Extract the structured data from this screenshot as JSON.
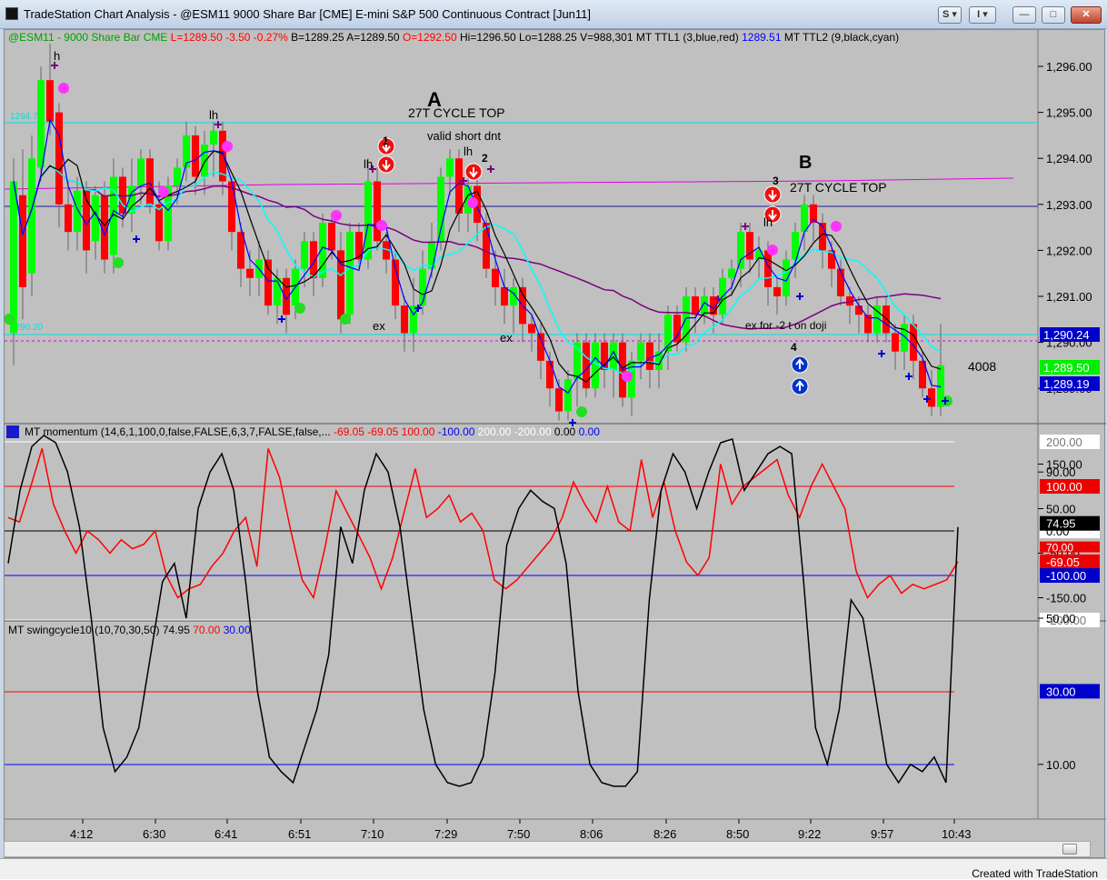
{
  "window": {
    "title": "TradeStation Chart Analysis - @ESM11 9000 Share Bar [CME] E-mini S&P 500 Continuous Contract [Jun11]",
    "buttons": {
      "s_label": "S",
      "i_label": "I",
      "minimize": "—",
      "maximize": "□",
      "close": "✕"
    }
  },
  "price_pane": {
    "header": [
      {
        "text": "@ESM11 - 9000 Share Bar  CME",
        "color": "#00a000"
      },
      {
        "text": "L=1289.50  -3.50  -0.27%",
        "color": "#ff0000"
      },
      {
        "text": "B=1289.25  A=1289.50",
        "color": "#000000"
      },
      {
        "text": "O=1292.50",
        "color": "#ff0000"
      },
      {
        "text": "Hi=1296.50  Lo=1288.25  V=988,301  MT  TTL1 (3,blue,red)",
        "color": "#000000"
      },
      {
        "text": "1289.51",
        "color": "#0000ff"
      },
      {
        "text": "MT  TTL2 (9,black,cyan)",
        "color": "#000000"
      }
    ],
    "axis_ticks": [
      "1,296.00",
      "1,295.00",
      "1,294.00",
      "1,293.00",
      "1,292.00",
      "1,291.00",
      "1,290.00",
      "1,289.00"
    ],
    "tag_1290_24": "1,290.24",
    "tag_1289_50": "1,289.50",
    "tag_1289_19": "1,289.19",
    "left_label_top": "1294.7",
    "left_label_bottom": "1290.20",
    "annotations": {
      "A": "A",
      "B": "B",
      "cycle_top_a": "27T CYCLE TOP",
      "cycle_top_b": "27T CYCLE TOP",
      "valid_short": "valid short dnt",
      "ex_for_doji": "ex for -2 t on doji",
      "ex1": "ex",
      "ex2": "ex",
      "h": "h",
      "lh1": "lh",
      "lh2": "lh",
      "lh3": "lh",
      "lh4": "lh",
      "n1": "1",
      "n2": "2",
      "n3": "3",
      "n4": "4",
      "count": "4008"
    }
  },
  "momentum_pane": {
    "header": [
      {
        "text": "MT  momentum (14,6,1,100,0,false,FALSE,6,3,7,FALSE,false,...",
        "color": "#000000"
      },
      {
        "text": "-69.05",
        "color": "#ff0000"
      },
      {
        "text": "-69.05",
        "color": "#ff0000"
      },
      {
        "text": "100.00",
        "color": "#ff0000"
      },
      {
        "text": "-100.00",
        "color": "#0000ff"
      },
      {
        "text": "200.00",
        "color": "#ffffff"
      },
      {
        "text": "-200.00",
        "color": "#ffffff"
      },
      {
        "text": "0.00",
        "color": "#000000"
      },
      {
        "text": "0.00",
        "color": "#0000ff"
      }
    ],
    "axis_ticks": [
      "200.00",
      "150.00",
      "100.00",
      "50.00",
      "0.00",
      "-50.00",
      "-69.05",
      "-100.00",
      "-150.00",
      "-200.00"
    ]
  },
  "swing_pane": {
    "header": [
      {
        "text": "MT  swingcycle10 (10,70,30,50)",
        "color": "#000000"
      },
      {
        "text": "74.95",
        "color": "#000000"
      },
      {
        "text": "70.00",
        "color": "#ff0000"
      },
      {
        "text": "30.00",
        "color": "#0000ff"
      }
    ],
    "axis_ticks": [
      "90.00",
      "74.95",
      "70.00",
      "50.00",
      "30.00",
      "10.00"
    ]
  },
  "time_axis": [
    "4:12",
    "6:30",
    "6:41",
    "6:51",
    "7:10",
    "7:29",
    "7:50",
    "8:06",
    "8:26",
    "8:50",
    "9:22",
    "9:57",
    "10:43"
  ],
  "status": {
    "created": "Created with TradeStation"
  },
  "colors": {
    "up": "#00ff00",
    "down": "#ff0000",
    "bg": "#c0c0c0",
    "ttl1": "#0000ff",
    "ttl2": "#00ffff"
  },
  "chart_data": [
    {
      "type": "candlestick",
      "title": "@ESM11 9000 Share Bar",
      "x": [
        "4:12",
        "6:30",
        "6:41",
        "6:51",
        "7:10",
        "7:29",
        "7:50",
        "8:06",
        "8:26",
        "8:50",
        "9:22",
        "9:57",
        "10:43"
      ],
      "ylim": [
        1288.25,
        1296.5
      ],
      "close": [
        1292.0,
        1294.0,
        1295.2,
        1293.0,
        1292.5,
        1293.6,
        1292.0,
        1291.0,
        1293.0,
        1292.0,
        1290.8,
        1289.2,
        1289.4,
        1290.5,
        1291.0,
        1291.2,
        1292.6,
        1292.2,
        1291.8,
        1290.8,
        1289.8,
        1289.2,
        1289.4,
        1289.5
      ],
      "high": 1296.5,
      "low": 1288.25,
      "last": 1289.5
    },
    {
      "type": "line",
      "title": "MT momentum",
      "ylim": [
        -200,
        200
      ],
      "values": [
        30,
        20,
        100,
        185,
        60,
        0,
        -50,
        0,
        -20,
        -50,
        -20,
        -40,
        -30,
        0,
        -100,
        -150,
        -130,
        -120,
        -80,
        -50,
        0,
        30,
        -80,
        185,
        120,
        0,
        -110,
        -150,
        -40,
        90,
        40,
        -10,
        -60,
        -130,
        -60,
        40,
        140,
        30,
        50,
        80,
        20,
        40,
        0,
        -110,
        -130,
        -110,
        -80,
        -50,
        -20,
        30,
        110,
        60,
        20,
        100,
        20,
        0,
        160,
        30,
        110,
        0,
        -70,
        -100,
        -60,
        150,
        60,
        100,
        120,
        140,
        160,
        80,
        30,
        100,
        150,
        100,
        50,
        -90,
        -150,
        -120,
        -100,
        -140,
        -120,
        -130,
        -120,
        -110,
        -69.05
      ],
      "ref_lines": [
        100,
        0,
        -100
      ]
    },
    {
      "type": "line",
      "title": "MT swingcycle10",
      "ylim": [
        0,
        100
      ],
      "values": [
        74.95
      ],
      "ref_lines": [
        70,
        30
      ],
      "last": 74.95
    }
  ]
}
